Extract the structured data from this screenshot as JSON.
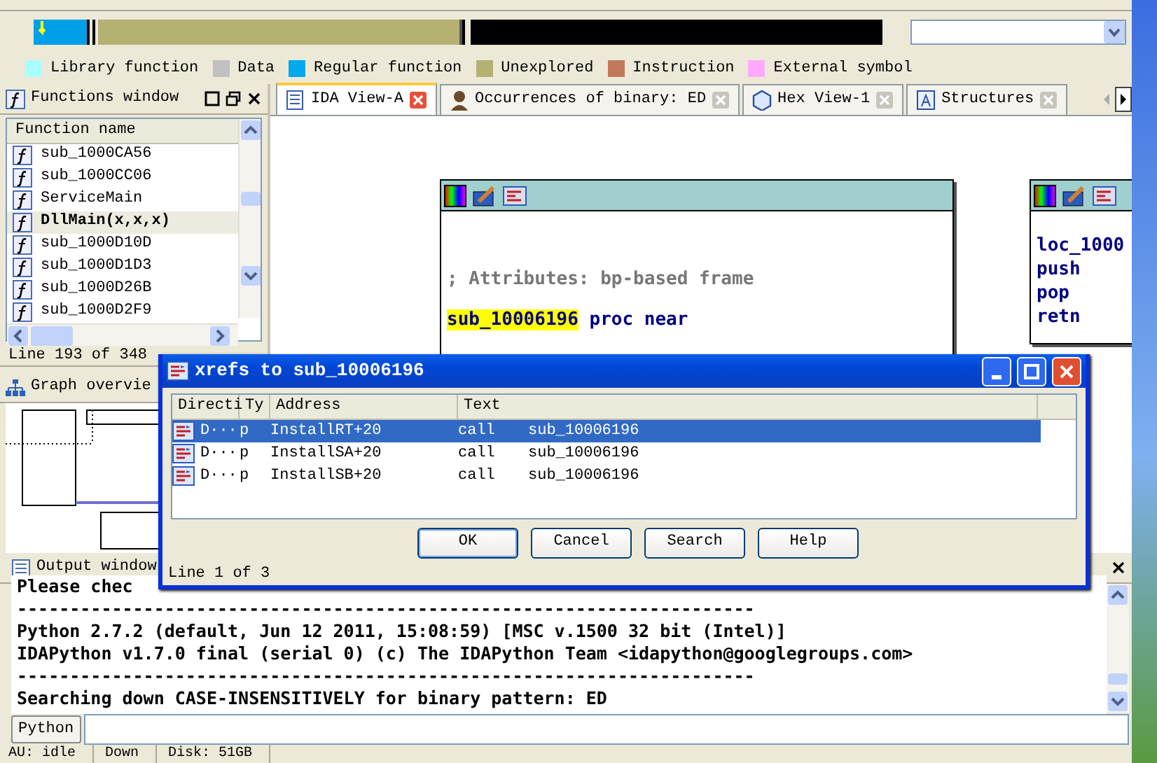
{
  "legend": [
    {
      "label": "Library function",
      "color": "#aaffff"
    },
    {
      "label": "Data",
      "color": "#c0c0c0"
    },
    {
      "label": "Regular function",
      "color": "#00aaee"
    },
    {
      "label": "Unexplored",
      "color": "#b5b173"
    },
    {
      "label": "Instruction",
      "color": "#c07a5a"
    },
    {
      "label": "External symbol",
      "color": "#ffaaff"
    }
  ],
  "functions_window": {
    "title": "Functions window",
    "column": "Function name",
    "items": [
      {
        "name": "sub_1000CA56",
        "selected": false
      },
      {
        "name": "sub_1000CC06",
        "selected": false
      },
      {
        "name": "ServiceMain",
        "selected": false
      },
      {
        "name": "DllMain(x,x,x)",
        "selected": true
      },
      {
        "name": "sub_1000D10D",
        "selected": false
      },
      {
        "name": "sub_1000D1D3",
        "selected": false
      },
      {
        "name": "sub_1000D26B",
        "selected": false
      },
      {
        "name": "sub_1000D2F9",
        "selected": false
      }
    ],
    "status": "Line 193 of 348"
  },
  "graph_overview": {
    "title": "Graph overvie"
  },
  "tabs": [
    {
      "label": "IDA View-A",
      "selected": true,
      "kind": "disassembly"
    },
    {
      "label": "Occurrences of binary: ED",
      "selected": false,
      "kind": "occurrences"
    },
    {
      "label": "Hex View-1",
      "selected": false,
      "kind": "hex"
    },
    {
      "label": "Structures",
      "selected": false,
      "kind": "structures"
    }
  ],
  "graph": {
    "nodes": [
      {
        "lines": [
          {
            "kind": "comment",
            "text": "; Attributes: bp-based frame"
          },
          {
            "kind": "proc",
            "name": "sub_10006196",
            "highlighted": true,
            "text": "proc near"
          }
        ]
      },
      {
        "lines": [
          {
            "kind": "code",
            "text": "loc_1000"
          },
          {
            "kind": "code",
            "text": "push"
          },
          {
            "kind": "code",
            "text": "pop"
          },
          {
            "kind": "code",
            "text": "retn"
          }
        ]
      }
    ]
  },
  "dialog": {
    "title": "xrefs to sub_10006196",
    "columns": [
      "Directi",
      "Ty",
      "Address",
      "Text"
    ],
    "rows": [
      {
        "direction": "D···",
        "type": "p",
        "address": "InstallRT+20",
        "text": "call",
        "operand": "sub_10006196",
        "selected": true
      },
      {
        "direction": "D···",
        "type": "p",
        "address": "InstallSA+20",
        "text": "call",
        "operand": "sub_10006196",
        "selected": false
      },
      {
        "direction": "D···",
        "type": "p",
        "address": "InstallSB+20",
        "text": "call",
        "operand": "sub_10006196",
        "selected": false
      }
    ],
    "buttons": [
      {
        "label": "OK",
        "default": true
      },
      {
        "label": "Cancel",
        "default": false
      },
      {
        "label": "Search",
        "default": false
      },
      {
        "label": "Help",
        "default": false
      }
    ],
    "status": "Line 1 of 3"
  },
  "output_window": {
    "title": "Output window",
    "lines": [
      "Please chec",
      "----------------------------------------------------------------------",
      "Python 2.7.2 (default, Jun 12 2011, 15:08:59) [MSC v.1500 32 bit (Intel)]",
      "IDAPython v1.7.0 final (serial 0) (c) The IDAPython Team <idapython@googlegroups.com>",
      "----------------------------------------------------------------------",
      "Searching down CASE-INSENSITIVELY for binary pattern: ED"
    ]
  },
  "command_line": {
    "button": "Python"
  },
  "status_bar": [
    "AU: idle",
    "Down",
    "Disk: 51GB"
  ]
}
